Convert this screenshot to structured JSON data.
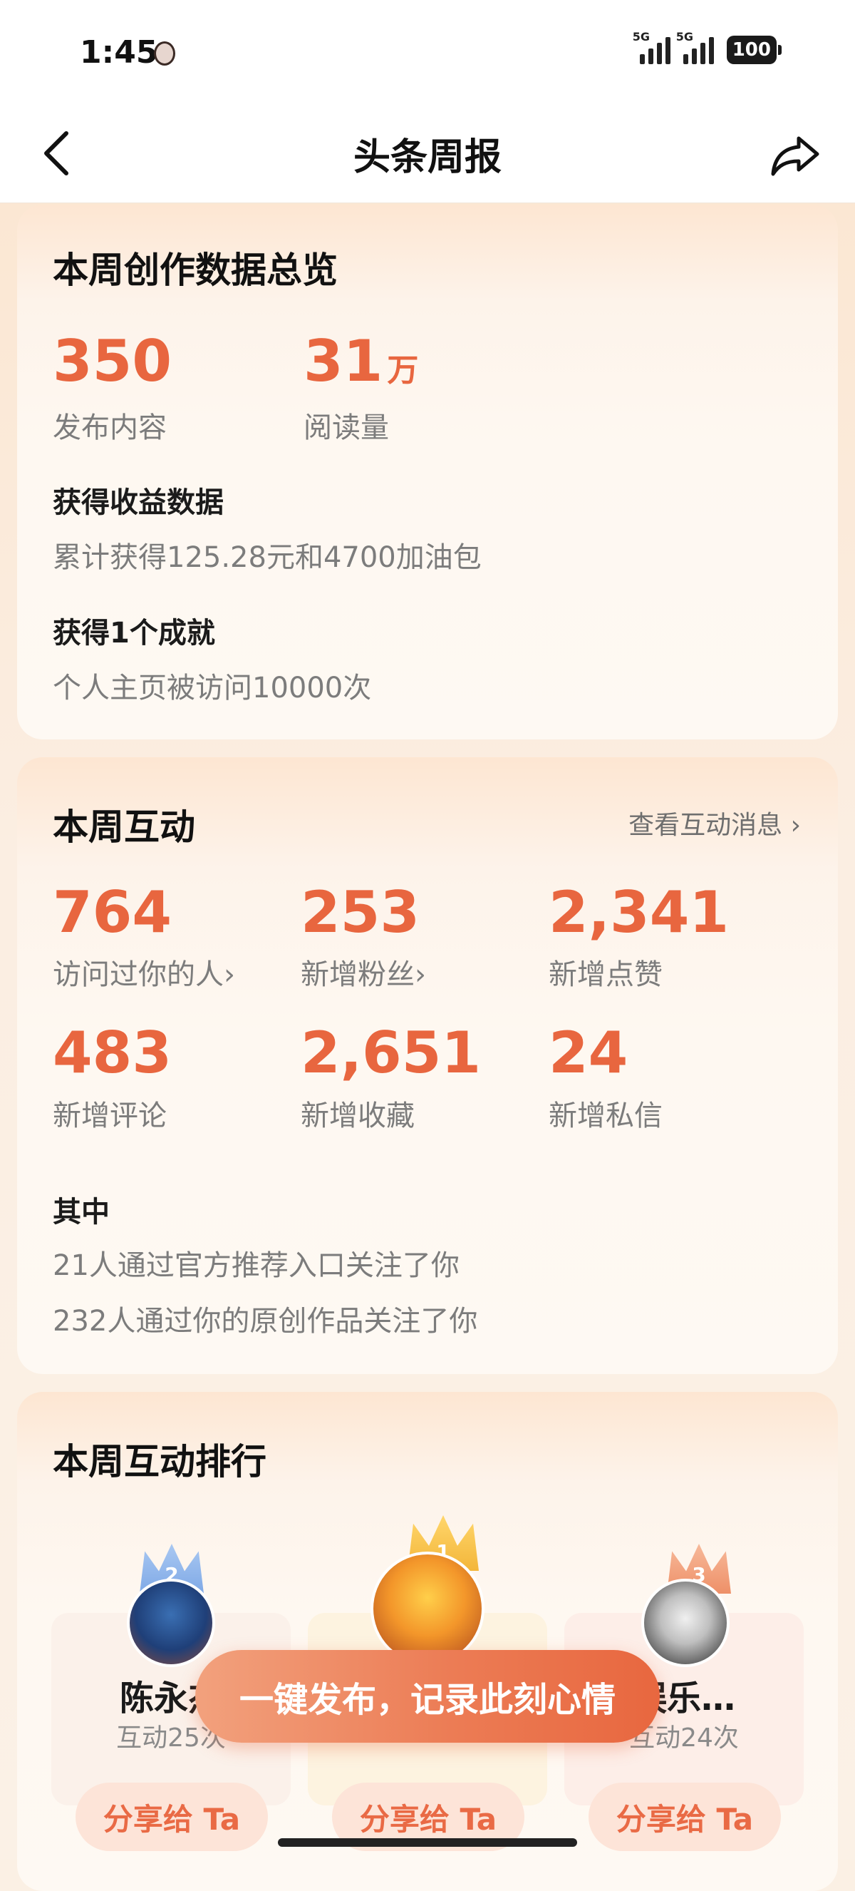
{
  "status_bar": {
    "time": "1:45",
    "network_1": "5G",
    "network_2": "5G",
    "battery": "100"
  },
  "nav": {
    "title": "头条周报"
  },
  "overview": {
    "title": "本周创作数据总览",
    "published_value": "350",
    "published_label": "发布内容",
    "reads_value": "31",
    "reads_unit": "万",
    "reads_label": "阅读量",
    "income_head": "获得收益数据",
    "income_text": "累计获得125.28元和4700加油包",
    "achievement_head": "获得1个成就",
    "achievement_text": "个人主页被访问10000次"
  },
  "interaction": {
    "title": "本周互动",
    "view_link": "查看互动消息",
    "metrics": [
      {
        "value": "764",
        "label": "访问过你的人"
      },
      {
        "value": "253",
        "label": "新增粉丝"
      },
      {
        "value": "2,341",
        "label": "新增点赞"
      },
      {
        "value": "483",
        "label": "新增评论"
      },
      {
        "value": "2,651",
        "label": "新增收藏"
      },
      {
        "value": "24",
        "label": "新增私信"
      }
    ],
    "detail_head": "其中",
    "detail_1": "21人通过官方推荐入口关注了你",
    "detail_2": "232人通过你的原创作品关注了你"
  },
  "ranking": {
    "title": "本周互动排行",
    "items": [
      {
        "rank": "2",
        "name": "陈永杰",
        "count": "互动25次",
        "share": "分享给 Ta"
      },
      {
        "rank": "1",
        "name": "",
        "count": "",
        "share": "分享给 Ta"
      },
      {
        "rank": "3",
        "name": "娱乐…",
        "count": "互动24次",
        "share": "分享给 Ta"
      }
    ]
  },
  "cta": {
    "label": "一键发布，记录此刻心情"
  },
  "colors": {
    "accent": "#e8663f",
    "card_bg": "#fef8f1",
    "page_bg": "#fbf0e4"
  }
}
